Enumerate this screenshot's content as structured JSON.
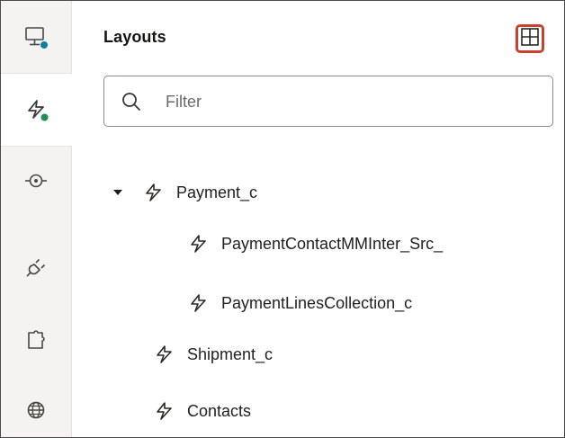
{
  "panel": {
    "title": "Layouts",
    "add_button_icon": "plus-icon",
    "highlight_color": "#c7432f"
  },
  "search": {
    "placeholder": "Filter",
    "value": ""
  },
  "rail": {
    "items": [
      {
        "icon": "monitor-icon",
        "badge_color": "#0a7fa5"
      },
      {
        "icon": "bolt-icon",
        "badge_color": "#1f8f4a",
        "active": true
      },
      {
        "icon": "service-connection-icon"
      },
      {
        "icon": "plug-icon"
      },
      {
        "icon": "puzzle-icon"
      },
      {
        "icon": "globe-icon"
      }
    ]
  },
  "tree": {
    "items": [
      {
        "label": "Payment_c",
        "expanded": true
      },
      {
        "label": "PaymentContactMMInter_Src_"
      },
      {
        "label": "PaymentLinesCollection_c"
      },
      {
        "label": "Shipment_c"
      },
      {
        "label": "Contacts"
      }
    ]
  }
}
